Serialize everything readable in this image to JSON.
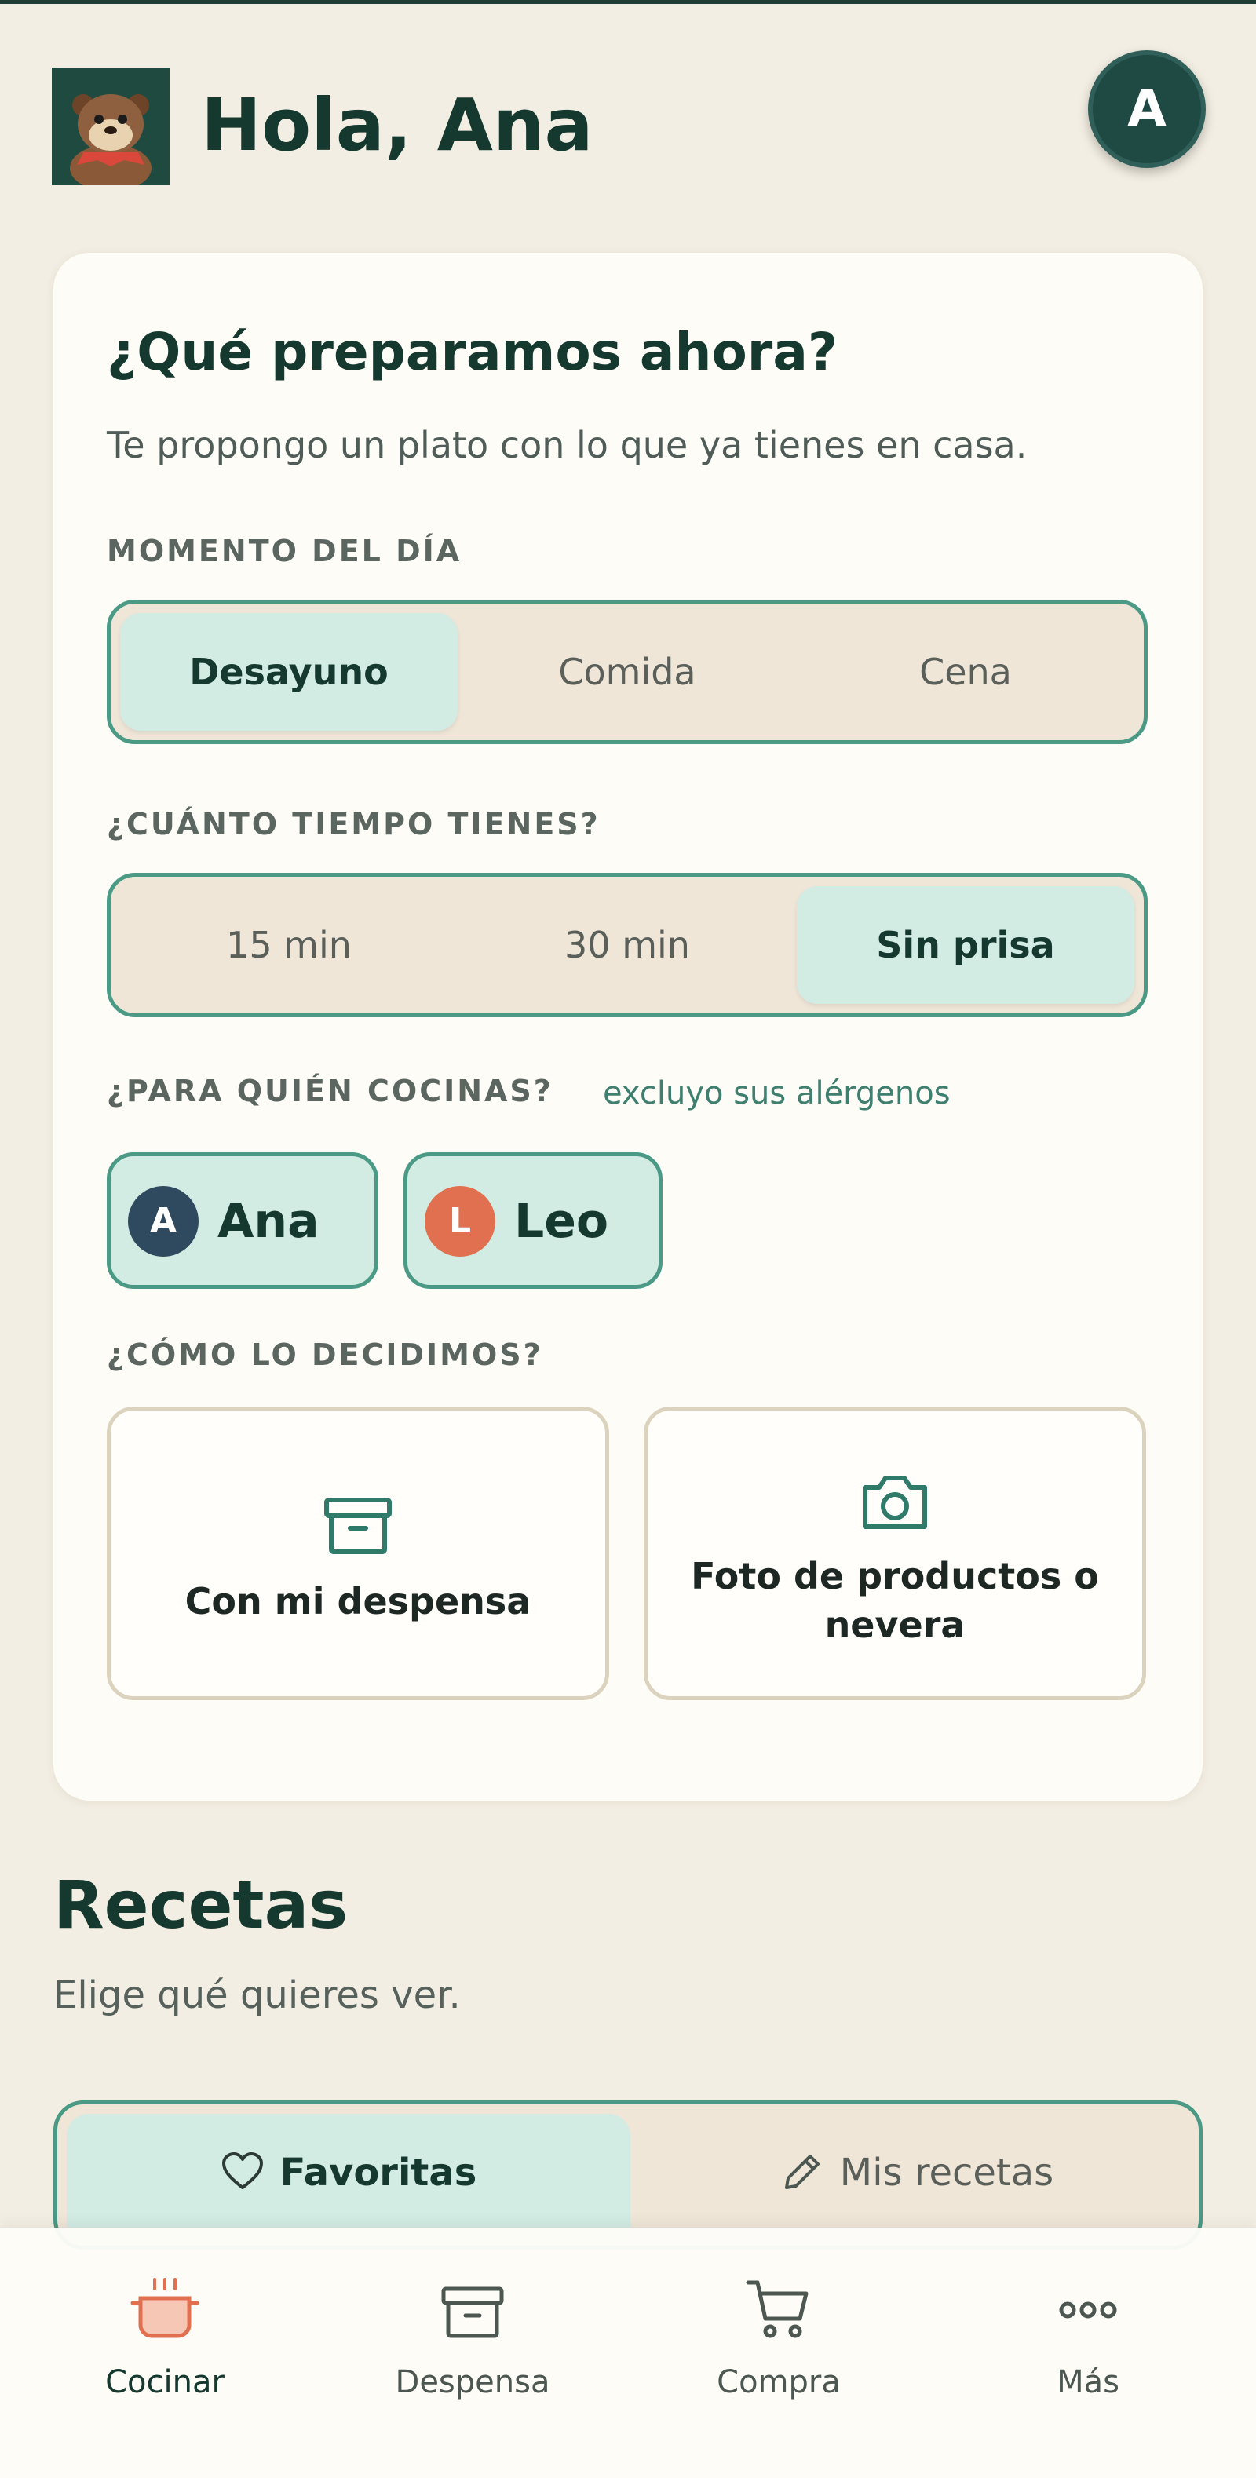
{
  "header": {
    "greeting": "Hola, Ana",
    "avatar_initial": "A"
  },
  "card": {
    "title": "¿Qué preparamos ahora?",
    "subtitle": "Te propongo un plato con lo que ya tienes en casa.",
    "moment": {
      "label": "MOMENTO DEL DÍA",
      "options": [
        "Desayuno",
        "Comida",
        "Cena"
      ],
      "selected": "Desayuno"
    },
    "time": {
      "label": "¿CUÁNTO TIEMPO TIENES?",
      "options": [
        "15 min",
        "30 min",
        "Sin prisa"
      ],
      "selected": "Sin prisa"
    },
    "people": {
      "label": "¿PARA QUIÉN COCINAS?",
      "note": "excluyo sus alérgenos",
      "members": [
        {
          "initial": "A",
          "name": "Ana",
          "color": "#2f4a5f"
        },
        {
          "initial": "L",
          "name": "Leo",
          "color": "#e0704f"
        }
      ]
    },
    "decide": {
      "label": "¿CÓMO LO DECIDIMOS?",
      "options": [
        {
          "label": "Con mi despensa",
          "icon": "box-icon"
        },
        {
          "label": "Foto de productos o nevera",
          "icon": "camera-icon"
        }
      ]
    }
  },
  "recipes": {
    "title": "Recetas",
    "subtitle": "Elige qué quieres ver.",
    "tabs": [
      {
        "label": "Favoritas",
        "icon": "heart-icon"
      },
      {
        "label": "Mis recetas",
        "icon": "pencil-icon"
      }
    ],
    "selected": "Favoritas"
  },
  "nav": {
    "items": [
      {
        "label": "Cocinar",
        "icon": "pot-icon"
      },
      {
        "label": "Despensa",
        "icon": "box-icon"
      },
      {
        "label": "Compra",
        "icon": "cart-icon"
      },
      {
        "label": "Más",
        "icon": "more-icon"
      }
    ],
    "active": "Cocinar"
  },
  "colors": {
    "accent": "#4a9a85",
    "selected_bg": "#d2ebe3",
    "background": "#f3eee3",
    "primary_text": "#16392f"
  }
}
